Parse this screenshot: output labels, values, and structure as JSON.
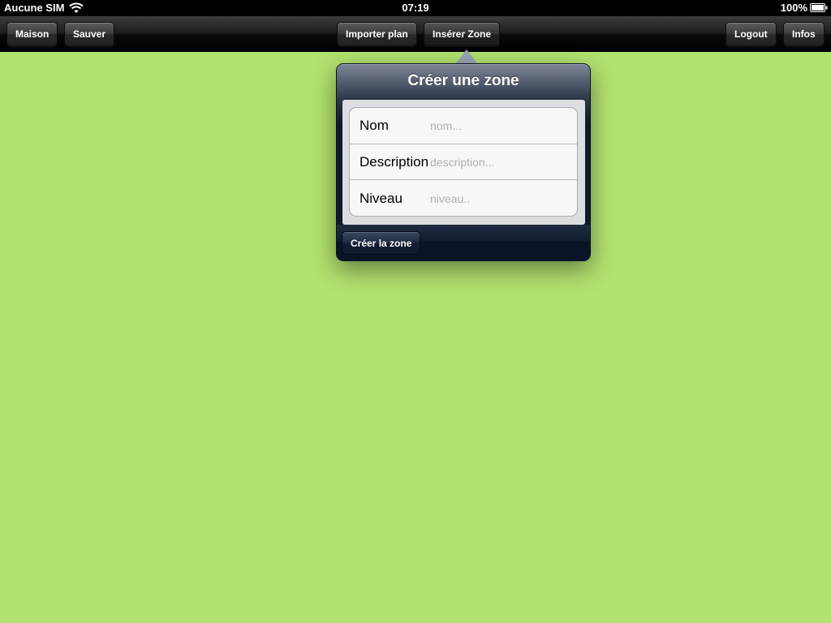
{
  "status_bar": {
    "carrier": "Aucune SIM",
    "time": "07:19",
    "battery": "100%"
  },
  "toolbar": {
    "maison_label": "Maison",
    "sauver_label": "Sauver",
    "importer_label": "Importer plan",
    "inserer_label": "Insérer Zone",
    "logout_label": "Logout",
    "infos_label": "Infos"
  },
  "popover": {
    "title": "Créer une zone",
    "fields": [
      {
        "label": "Nom",
        "placeholder": "nom..."
      },
      {
        "label": "Description",
        "placeholder": "description..."
      },
      {
        "label": "Niveau",
        "placeholder": "niveau.."
      }
    ],
    "create_label": "Créer la zone"
  },
  "colors": {
    "canvas": "#b2e26f",
    "toolbar": "#000000",
    "popover": "#0f1a2e"
  },
  "icons": {
    "wifi": "wifi-icon",
    "battery": "battery-icon"
  }
}
